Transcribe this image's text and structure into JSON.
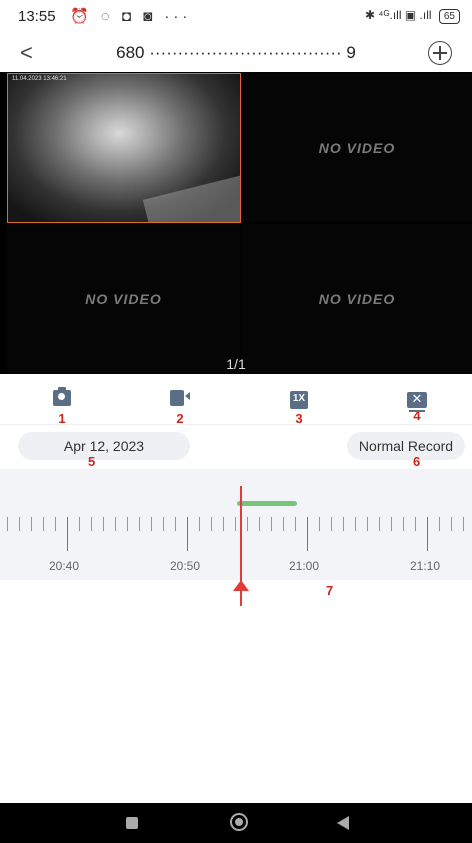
{
  "status_bar": {
    "time": "13:55",
    "left_icons": "⏰ ◌ ◘ ◙ ···",
    "right_icons": "✱ ⁴ᴳ.ıll ▣ .ıll",
    "battery": "65"
  },
  "header": {
    "title": "680 ·································· 9",
    "back_icon": "chevron-left-icon",
    "add_icon": "plus-circle-icon"
  },
  "video_grid": {
    "cells": [
      {
        "label": "",
        "timestamp": "11.04.2023 13:46:21"
      },
      {
        "label": "NO VIDEO"
      },
      {
        "label": "NO VIDEO"
      },
      {
        "label": "NO VIDEO"
      }
    ],
    "pager": "1/1"
  },
  "toolbar": {
    "items": [
      {
        "icon": "camera-icon",
        "number": "1"
      },
      {
        "icon": "video-record-icon",
        "number": "2"
      },
      {
        "icon": "speed-1x-icon",
        "label": "1X",
        "number": "3"
      },
      {
        "icon": "close-screen-icon",
        "label": "✕",
        "number": "4"
      }
    ]
  },
  "date_chip": {
    "label": "Apr 12, 2023",
    "number": "5"
  },
  "record_chip": {
    "label": "Normal Record",
    "number": "6"
  },
  "timeline": {
    "labels": [
      "20:40",
      "20:50",
      "21:00",
      "21:10"
    ],
    "number": "7",
    "cursor_color": "#e53a3a",
    "record_color": "#7ac37b"
  },
  "colors": {
    "accent_number": "#d0231c",
    "icon": "#5a6e86",
    "selected_border": "#e06a2c"
  }
}
